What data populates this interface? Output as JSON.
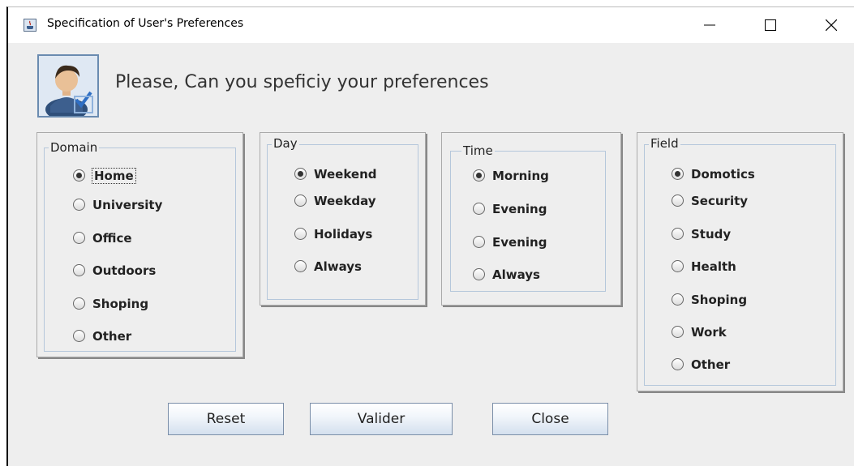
{
  "window": {
    "title": "Specification of User's Preferences"
  },
  "header": {
    "prompt": "Please, Can you speficiy your preferences"
  },
  "groups": {
    "domain": {
      "legend": "Domain",
      "options": [
        "Home",
        "University",
        "Office",
        "Outdoors",
        "Shoping",
        "Other"
      ],
      "selected": "Home"
    },
    "day": {
      "legend": "Day",
      "options": [
        "Weekend",
        "Weekday",
        "Holidays",
        "Always"
      ],
      "selected": "Weekend"
    },
    "time": {
      "legend": "Time",
      "options": [
        "Morning",
        "Evening",
        "Evening",
        "Always"
      ],
      "selected": "Morning"
    },
    "field": {
      "legend": "Field",
      "options": [
        "Domotics",
        "Security",
        "Study",
        "Health",
        "Shoping",
        "Work",
        "Other"
      ],
      "selected": "Domotics"
    }
  },
  "buttons": {
    "reset": "Reset",
    "valider": "Valider",
    "close": "Close"
  },
  "icons": {
    "app": "java-icon",
    "user": "user-check-icon",
    "minimize": "minimize-icon",
    "maximize": "maximize-icon",
    "close": "close-icon"
  }
}
